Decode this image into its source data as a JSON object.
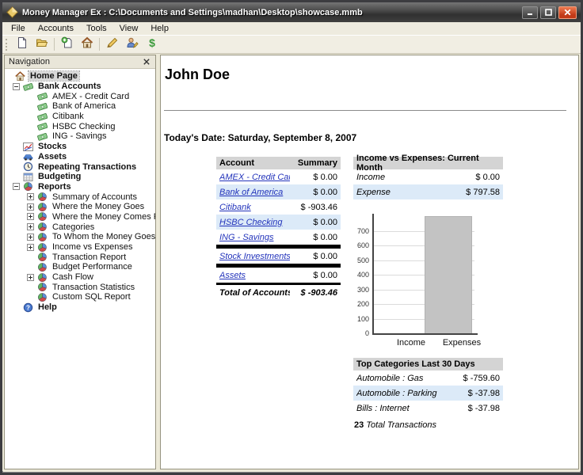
{
  "window": {
    "title": "Money Manager Ex : C:\\Documents and Settings\\madhan\\Desktop\\showcase.mmb"
  },
  "menu": [
    "File",
    "Accounts",
    "Tools",
    "View",
    "Help"
  ],
  "toolbar": [
    {
      "icon": "new-file-icon"
    },
    {
      "icon": "open-file-icon"
    },
    {
      "sep": true
    },
    {
      "icon": "new-account-icon"
    },
    {
      "icon": "home-icon"
    },
    {
      "sep": true
    },
    {
      "icon": "organize-categories-icon"
    },
    {
      "icon": "organize-payees-icon"
    },
    {
      "icon": "currency-icon"
    }
  ],
  "navigation": {
    "header": "Navigation",
    "items": [
      {
        "label": "Home Page",
        "icon": "home",
        "root": true,
        "bold": true,
        "selected": true,
        "level": 0
      },
      {
        "label": "Bank Accounts",
        "icon": "money",
        "bold": true,
        "level": 0,
        "expander": "minus"
      },
      {
        "label": "AMEX - Credit Card",
        "icon": "money",
        "level": 1
      },
      {
        "label": "Bank of America",
        "icon": "money",
        "level": 1
      },
      {
        "label": "Citibank",
        "icon": "money",
        "level": 1
      },
      {
        "label": "HSBC Checking",
        "icon": "money",
        "level": 1
      },
      {
        "label": "ING - Savings",
        "icon": "money",
        "level": 1
      },
      {
        "label": "Stocks",
        "icon": "stocks",
        "bold": true,
        "level": 0
      },
      {
        "label": "Assets",
        "icon": "car",
        "bold": true,
        "level": 0
      },
      {
        "label": "Repeating Transactions",
        "icon": "clock",
        "bold": true,
        "level": 0
      },
      {
        "label": "Budgeting",
        "icon": "calendar",
        "bold": true,
        "level": 0
      },
      {
        "label": "Reports",
        "icon": "pie",
        "bold": true,
        "level": 0,
        "expander": "minus"
      },
      {
        "label": "Summary of Accounts",
        "icon": "pie",
        "level": 1,
        "expander": "plus"
      },
      {
        "label": "Where the Money Goes",
        "icon": "pie",
        "level": 1,
        "expander": "plus"
      },
      {
        "label": "Where the Money Comes From",
        "icon": "pie",
        "level": 1,
        "expander": "plus"
      },
      {
        "label": "Categories",
        "icon": "pie",
        "level": 1,
        "expander": "plus"
      },
      {
        "label": "To Whom the Money Goes",
        "icon": "pie",
        "level": 1,
        "expander": "plus"
      },
      {
        "label": "Income vs Expenses",
        "icon": "pie",
        "level": 1,
        "expander": "plus"
      },
      {
        "label": "Transaction Report",
        "icon": "pie",
        "level": 1
      },
      {
        "label": "Budget Performance",
        "icon": "pie",
        "level": 1
      },
      {
        "label": "Cash Flow",
        "icon": "pie",
        "level": 1,
        "expander": "plus"
      },
      {
        "label": "Transaction Statistics",
        "icon": "pie",
        "level": 1
      },
      {
        "label": "Custom SQL Report",
        "icon": "pie",
        "level": 1
      },
      {
        "label": "Help",
        "icon": "help",
        "bold": true,
        "level": 0
      }
    ]
  },
  "main": {
    "user_name": "John Doe",
    "date_line": "Today's Date: Saturday, September 8, 2007",
    "accounts_table": {
      "headers": [
        "Account",
        "Summary"
      ],
      "groups": [
        {
          "rows": [
            {
              "label": "AMEX - Credit Card",
              "value": "$ 0.00"
            },
            {
              "label": "Bank of America",
              "value": "$ 0.00",
              "alt": true
            },
            {
              "label": "Citibank",
              "value": "$ -903.46"
            },
            {
              "label": "HSBC Checking",
              "value": "$ 0.00",
              "alt": true
            },
            {
              "label": "ING - Savings",
              "value": "$ 0.00"
            }
          ]
        },
        {
          "rows": [
            {
              "label": "Stock Investments",
              "value": "$ 0.00"
            }
          ]
        },
        {
          "rows": [
            {
              "label": "Assets",
              "value": "$ 0.00"
            }
          ]
        }
      ],
      "total_label": "Total of Accounts:",
      "total_value": "$ -903.46"
    },
    "income_expenses": {
      "header": "Income vs Expenses: Current Month",
      "rows": [
        {
          "label": "Income",
          "value": "$ 0.00"
        },
        {
          "label": "Expense",
          "value": "$ 797.58",
          "alt": true
        }
      ]
    },
    "top_categories": {
      "header": "Top Categories Last 30 Days",
      "rows": [
        {
          "label": "Automobile : Gas",
          "value": "$ -759.60"
        },
        {
          "label": "Automobile : Parking",
          "value": "$ -37.98",
          "alt": true
        },
        {
          "label": "Bills : Internet",
          "value": "$ -37.98"
        }
      ]
    },
    "transactions_note": {
      "count": "23",
      "text": "Total Transactions"
    }
  },
  "chart_data": {
    "type": "bar",
    "categories": [
      "Income",
      "Expenses"
    ],
    "values": [
      0,
      797.58
    ],
    "title": "Income vs Expenses: Current Month",
    "xlabel": "",
    "ylabel": "",
    "ylim": [
      0,
      800
    ],
    "yticks": [
      0,
      100,
      200,
      300,
      400,
      500,
      600,
      700
    ],
    "grid": true,
    "legend_position": "none",
    "bar_color": "#c3c3c3"
  },
  "colors": {
    "titlebar_dark": "#3a3a3a",
    "close_button_red": "#c23a18",
    "table_header_gray": "#d4d4d4",
    "alt_row_blue": "#dceaf8",
    "link_blue": "#2233bb",
    "chrome_beige": "#ece9d8",
    "bar_gray": "#c3c3c3"
  }
}
